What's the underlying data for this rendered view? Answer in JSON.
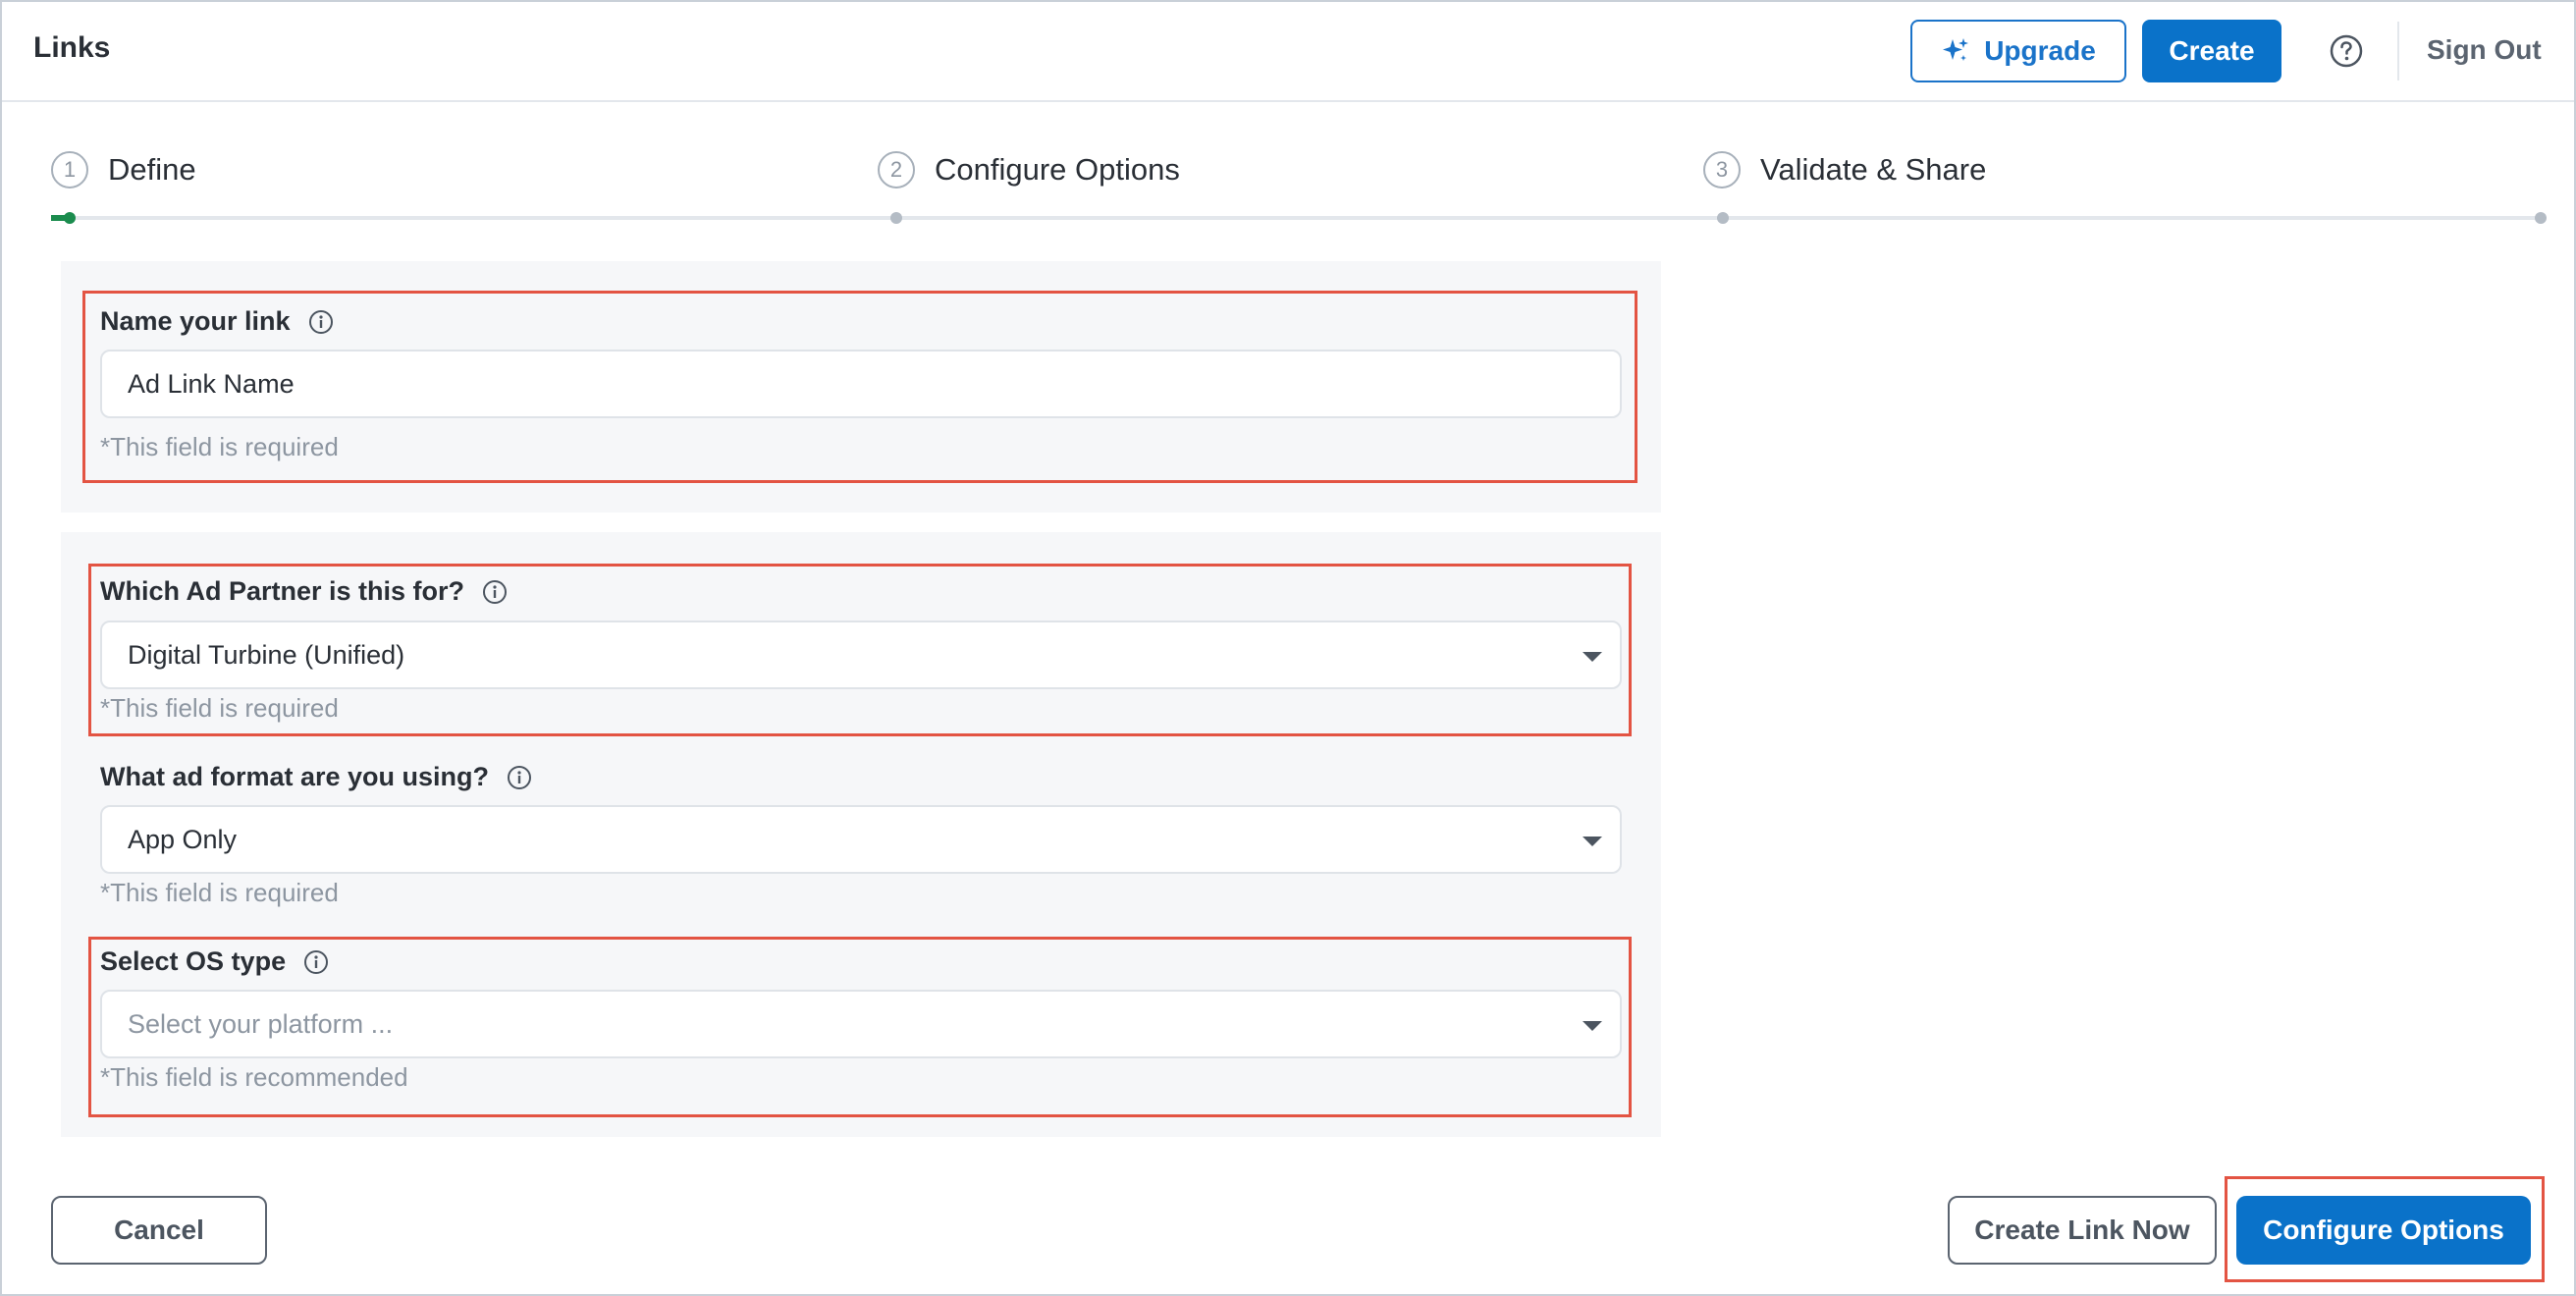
{
  "header": {
    "title": "Links",
    "upgrade_label": "Upgrade",
    "create_label": "Create",
    "signout_label": "Sign Out"
  },
  "stepper": {
    "steps": [
      {
        "num": "1",
        "label": "Define"
      },
      {
        "num": "2",
        "label": "Configure Options"
      },
      {
        "num": "3",
        "label": "Validate & Share"
      }
    ]
  },
  "form": {
    "link_name": {
      "label": "Name your link",
      "value": "Ad Link Name",
      "hint": "*This field is required"
    },
    "ad_partner": {
      "label": "Which Ad Partner is this for?",
      "value": "Digital Turbine (Unified)",
      "hint": "*This field is required"
    },
    "ad_format": {
      "label": "What ad format are you using?",
      "value": "App Only",
      "hint": "*This field is required"
    },
    "os_type": {
      "label": "Select OS type",
      "placeholder": "Select your platform ...",
      "hint": "*This field is recommended"
    }
  },
  "footer": {
    "cancel_label": "Cancel",
    "create_link_now_label": "Create Link Now",
    "configure_options_label": "Configure Options"
  },
  "colors": {
    "primary": "#0a72c9",
    "highlight": "#e35443",
    "progress": "#1b8c4e"
  }
}
